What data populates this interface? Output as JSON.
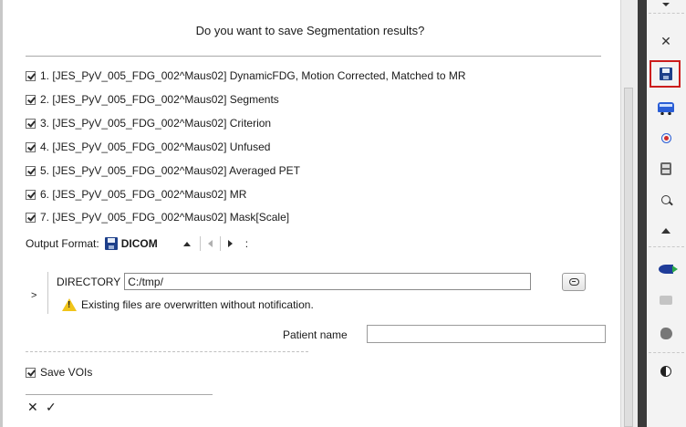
{
  "dialog": {
    "title": "Do you want to save Segmentation results?",
    "items": [
      {
        "label": "1. [JES_PyV_005_FDG_002^Maus02] DynamicFDG, Motion Corrected, Matched to MR",
        "checked": true
      },
      {
        "label": "2. [JES_PyV_005_FDG_002^Maus02] Segments",
        "checked": true
      },
      {
        "label": "3. [JES_PyV_005_FDG_002^Maus02] Criterion",
        "checked": true
      },
      {
        "label": "4. [JES_PyV_005_FDG_002^Maus02] Unfused",
        "checked": true
      },
      {
        "label": "5. [JES_PyV_005_FDG_002^Maus02] Averaged PET",
        "checked": true
      },
      {
        "label": "6. [JES_PyV_005_FDG_002^Maus02] MR",
        "checked": true
      },
      {
        "label": "7. [JES_PyV_005_FDG_002^Maus02] Mask[Scale]",
        "checked": true
      }
    ],
    "output_format": {
      "label": "Output Format:",
      "value": "DICOM",
      "colon": ":"
    },
    "expander": ">",
    "directory": {
      "label": "DIRECTORY",
      "value": "C:/tmp/"
    },
    "warning": "Existing files are overwritten without notification.",
    "patient_name": {
      "label": "Patient name",
      "value": ""
    },
    "save_vois": {
      "label": "Save VOIs",
      "checked": true
    },
    "actions": {
      "cancel": "✕",
      "ok": "✓"
    }
  },
  "toolbar": {
    "highlight_color": "#cc1d1d",
    "icons": [
      "collapse-icon",
      "close-icon",
      "save-icon",
      "bus-icon",
      "target-icon",
      "control-icon",
      "zoom-icon",
      "triangle-up-icon",
      "fish-icon",
      "print-icon",
      "head-icon",
      "contrast-icon"
    ]
  }
}
